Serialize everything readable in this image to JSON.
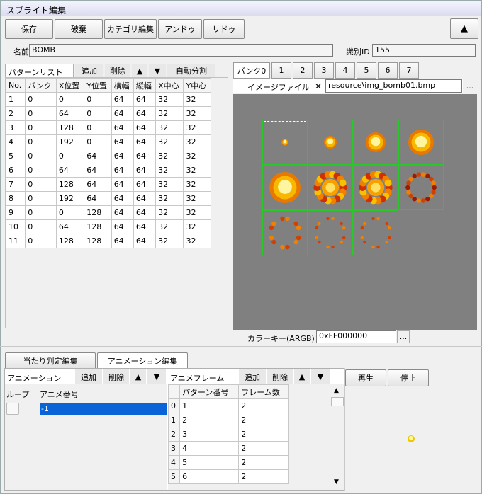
{
  "window": {
    "title": "スプライト編集"
  },
  "toolbar": {
    "save": "保存",
    "discard": "破棄",
    "category_edit": "カテゴリ編集",
    "undo": "アンドゥ",
    "redo": "リドゥ",
    "collapse": "▲"
  },
  "sprite": {
    "name_label": "名前",
    "name_value": "BOMB",
    "id_label": "識別ID",
    "id_value": "155"
  },
  "pattern_list": {
    "tab_label": "パターンリスト",
    "add": "追加",
    "delete": "削除",
    "up": "▲",
    "down": "▼",
    "auto_split": "自動分割",
    "columns": [
      "No.",
      "バンク",
      "X位置",
      "Y位置",
      "横幅",
      "縦幅",
      "X中心",
      "Y中心"
    ],
    "rows": [
      [
        "1",
        "0",
        "0",
        "0",
        "64",
        "64",
        "32",
        "32"
      ],
      [
        "2",
        "0",
        "64",
        "0",
        "64",
        "64",
        "32",
        "32"
      ],
      [
        "3",
        "0",
        "128",
        "0",
        "64",
        "64",
        "32",
        "32"
      ],
      [
        "4",
        "0",
        "192",
        "0",
        "64",
        "64",
        "32",
        "32"
      ],
      [
        "5",
        "0",
        "0",
        "64",
        "64",
        "64",
        "32",
        "32"
      ],
      [
        "6",
        "0",
        "64",
        "64",
        "64",
        "64",
        "32",
        "32"
      ],
      [
        "7",
        "0",
        "128",
        "64",
        "64",
        "64",
        "32",
        "32"
      ],
      [
        "8",
        "0",
        "192",
        "64",
        "64",
        "64",
        "32",
        "32"
      ],
      [
        "9",
        "0",
        "0",
        "128",
        "64",
        "64",
        "32",
        "32"
      ],
      [
        "10",
        "0",
        "64",
        "128",
        "64",
        "64",
        "32",
        "32"
      ],
      [
        "11",
        "0",
        "128",
        "128",
        "64",
        "64",
        "32",
        "32"
      ]
    ]
  },
  "banks": {
    "tabs": [
      "バンク0",
      "1",
      "2",
      "3",
      "4",
      "5",
      "6",
      "7"
    ],
    "active": 0
  },
  "image": {
    "label": "イメージファイル",
    "clear": "✕",
    "path": "resource\\img_bomb01.bmp",
    "browse": "..."
  },
  "colorkey": {
    "label": "カラーキー(ARGB)",
    "value": "0xFF000000",
    "browse": "..."
  },
  "bottom_tabs": {
    "collision": "当たり判定編集",
    "animation": "アニメーション編集"
  },
  "animation": {
    "label": "アニメーション",
    "add": "追加",
    "delete": "削除",
    "up": "▲",
    "down": "▼",
    "loop_col": "ループ",
    "number_col": "アニメ番号",
    "rows": [
      {
        "number": "-1"
      }
    ]
  },
  "frames": {
    "label": "アニメフレーム",
    "add": "追加",
    "delete": "削除",
    "up": "▲",
    "down": "▼",
    "columns": [
      "",
      "パターン番号",
      "フレーム数"
    ],
    "rows": [
      [
        "0",
        "1",
        "2"
      ],
      [
        "1",
        "2",
        "2"
      ],
      [
        "2",
        "3",
        "2"
      ],
      [
        "3",
        "4",
        "2"
      ],
      [
        "4",
        "5",
        "2"
      ],
      [
        "5",
        "6",
        "2"
      ]
    ]
  },
  "playback": {
    "play": "再生",
    "stop": "停止"
  },
  "colors": {
    "selection": "#0a64d8",
    "grid_line": "#28c828",
    "canvas": "#808080"
  }
}
